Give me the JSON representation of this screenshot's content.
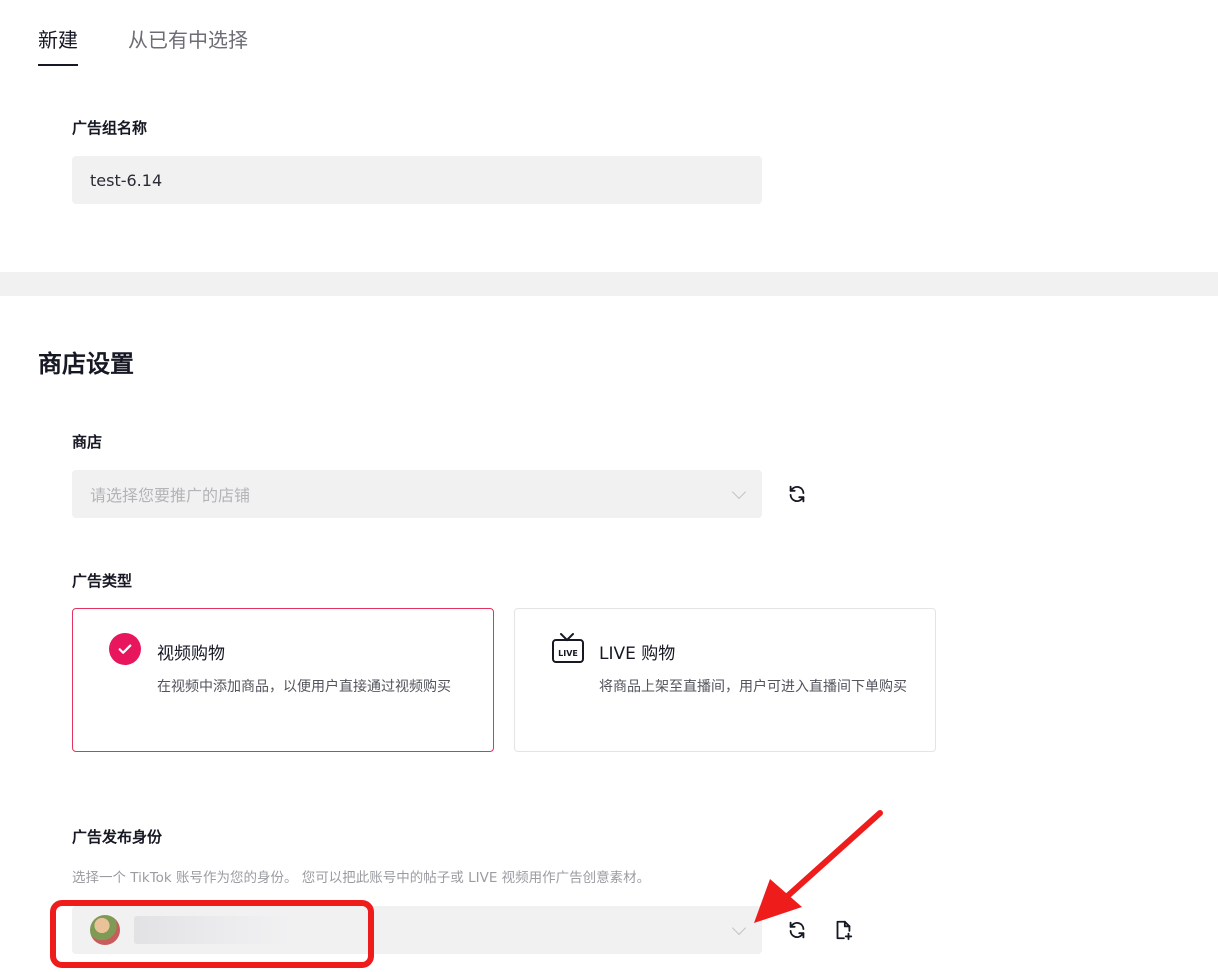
{
  "tabs": [
    {
      "label": "新建",
      "active": true
    },
    {
      "label": "从已有中选择",
      "active": false
    }
  ],
  "ad_group": {
    "label": "广告组名称",
    "value": "test-6.14"
  },
  "shop_settings": {
    "title": "商店设置",
    "shop": {
      "label": "商店",
      "placeholder": "请选择您要推广的店铺",
      "refresh_icon": "refresh-icon"
    },
    "ad_type": {
      "label": "广告类型",
      "options": [
        {
          "title": "视频购物",
          "desc": "在视频中添加商品，以便用户直接通过视频购买",
          "selected": true,
          "icon": "check-circle-icon"
        },
        {
          "title": "LIVE 购物",
          "desc": "将商品上架至直播间，用户可进入直播间下单购买",
          "selected": false,
          "icon": "live-tv-icon"
        }
      ]
    },
    "identity": {
      "label": "广告发布身份",
      "hint": "选择一个 TikTok 账号作为您的身份。 您可以把此账号中的帖子或 LIVE 视频用作广告创意素材。",
      "refresh_icon": "refresh-icon",
      "add_icon": "add-file-icon"
    }
  },
  "colors": {
    "accent": "#e8175d",
    "selected_border": "#e4335f",
    "annotation": "#ef1c1c",
    "field_bg": "#f1f1f2"
  }
}
